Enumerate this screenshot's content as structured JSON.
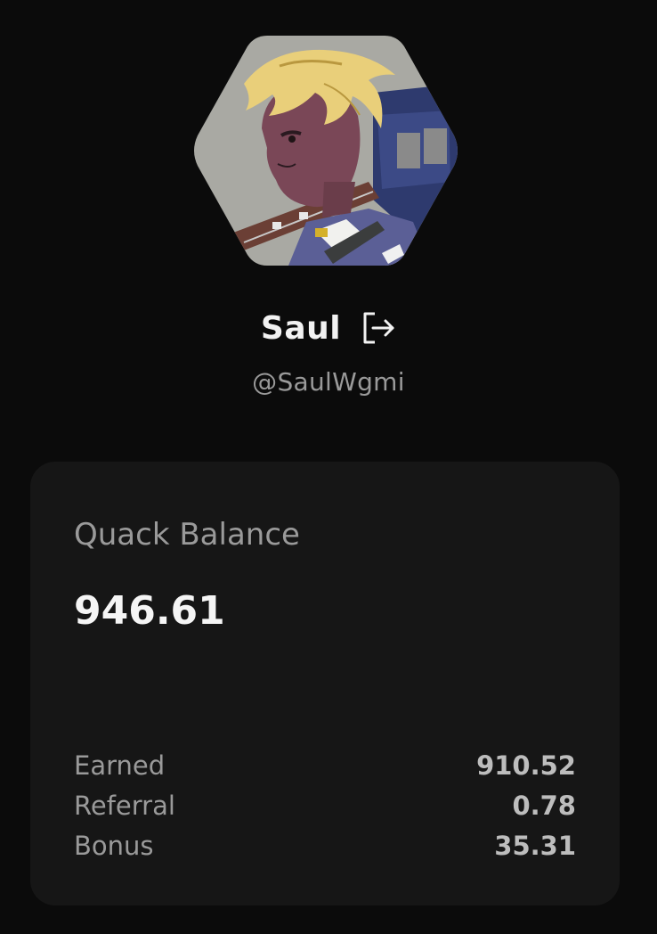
{
  "profile": {
    "name": "Saul",
    "handle": "@SaulWgmi",
    "avatar_icon": "hexagon-avatar-anime-guitarist",
    "logout_icon": "logout-icon"
  },
  "balance": {
    "title": "Quack Balance",
    "total": "946.61",
    "rows": [
      {
        "label": "Earned",
        "value": "910.52"
      },
      {
        "label": "Referral",
        "value": "0.78"
      },
      {
        "label": "Bonus",
        "value": "35.31"
      }
    ]
  },
  "colors": {
    "background": "#0b0b0b",
    "card": "#161616",
    "text_primary": "#f2f2f2",
    "text_muted": "#9a9a9a"
  }
}
